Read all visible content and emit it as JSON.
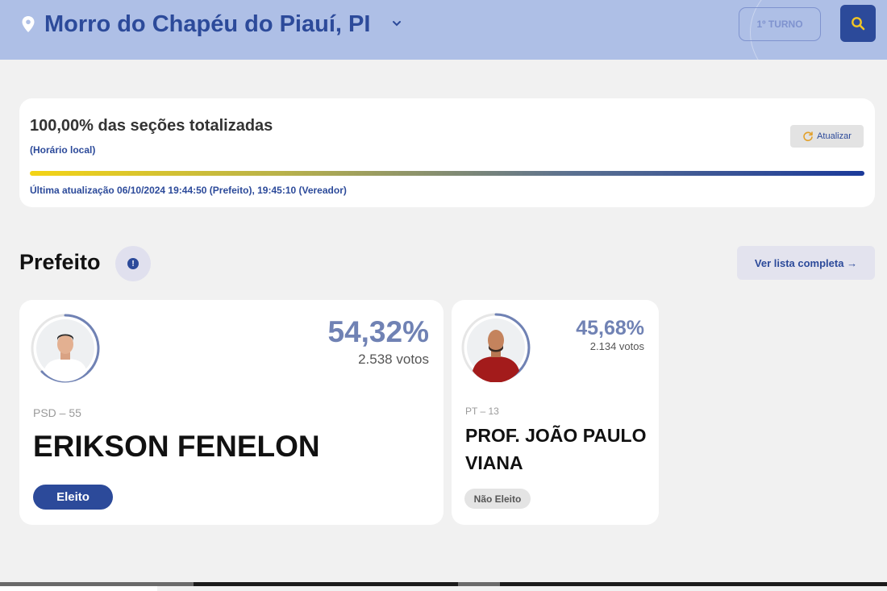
{
  "header": {
    "city": "Morro do Chapéu do Piauí, PI",
    "turno_label": "1º TURNO"
  },
  "status": {
    "percent_text": "100,00% das seções totalizadas",
    "horario_label": "(Horário local)",
    "refresh_label": "Atualizar",
    "progress_percent": 100,
    "last_update": "Última atualização 06/10/2024 19:44:50 (Prefeito), 19:45:10 (Vereador)"
  },
  "section": {
    "title": "Prefeito",
    "ver_lista_label": "Ver lista completa →"
  },
  "candidates": [
    {
      "percent": "54,32%",
      "votes": "2.538 votos",
      "party": "PSD – 55",
      "name": "ERIKSON FENELON",
      "status": "Eleito"
    },
    {
      "percent": "45,68%",
      "votes": "2.134 votos",
      "party": "PT – 13",
      "name": "PROF. JOÃO PAULO VIANA",
      "status": "Não Eleito"
    }
  ],
  "colors": {
    "brand": "#2c4a9a",
    "header_bg": "#aebfe6",
    "percent_text": "#7082b4",
    "progress_start": "#f4d416",
    "progress_end": "#1b3a9a"
  }
}
